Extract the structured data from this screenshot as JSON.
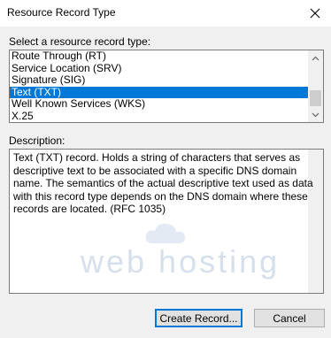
{
  "window": {
    "title": "Resource Record Type",
    "close_icon": "close-icon"
  },
  "record_select": {
    "label": "Select a resource record type:",
    "items": [
      {
        "label": "Route Through (RT)",
        "selected": false
      },
      {
        "label": "Service Location (SRV)",
        "selected": false
      },
      {
        "label": "Signature (SIG)",
        "selected": false
      },
      {
        "label": "Text (TXT)",
        "selected": true
      },
      {
        "label": "Well Known Services (WKS)",
        "selected": false
      },
      {
        "label": "X.25",
        "selected": false
      }
    ]
  },
  "description": {
    "label": "Description:",
    "text": "Text (TXT) record. Holds a string of characters that serves as descriptive text to be associated with a specific DNS domain name. The semantics of the actual descriptive text used as data with this record type depends on the DNS domain where these records are located. (RFC 1035)"
  },
  "watermark": {
    "text": "web hosting"
  },
  "buttons": {
    "create": "Create Record...",
    "cancel": "Cancel"
  },
  "colors": {
    "selection": "#0078d7",
    "window_bg": "#f0f0f0"
  }
}
